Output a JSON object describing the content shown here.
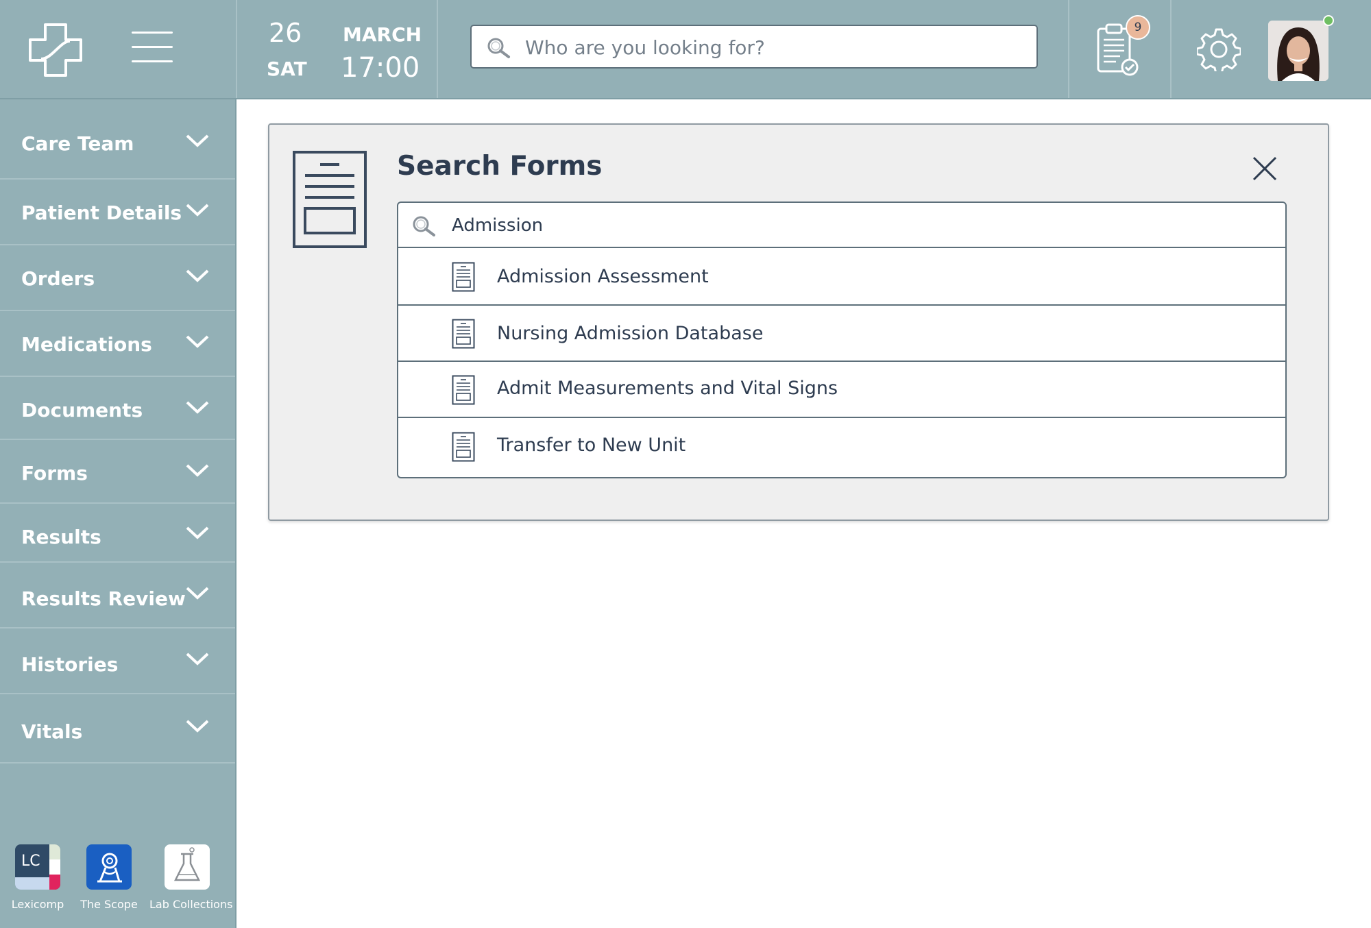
{
  "header": {
    "date_day": "26",
    "date_dow": "SAT",
    "date_month": "MARCH",
    "time": "17:00",
    "search_placeholder": "Who are you looking for?",
    "notification_count": "9",
    "logo_icon": "medical-cross-icon",
    "menu_icon": "hamburger-menu-icon",
    "tasks_icon": "clipboard-check-icon",
    "settings_icon": "gear-icon",
    "online_status_color": "#6fbe62"
  },
  "sidebar": {
    "items": [
      {
        "label": "Care Team"
      },
      {
        "label": "Patient Details"
      },
      {
        "label": "Orders"
      },
      {
        "label": "Medications"
      },
      {
        "label": "Documents"
      },
      {
        "label": "Forms"
      },
      {
        "label": "Results"
      },
      {
        "label": "Results Review"
      },
      {
        "label": "Histories"
      },
      {
        "label": "Vitals"
      }
    ],
    "apps": [
      {
        "label": "Lexicomp",
        "tile_text": "LC"
      },
      {
        "label": "The Scope"
      },
      {
        "label": "Lab Collections"
      }
    ]
  },
  "search_forms": {
    "title": "Search Forms",
    "query": "Admission",
    "results": [
      {
        "label": "Admission Assessment"
      },
      {
        "label": "Nursing Admission Database"
      },
      {
        "label": "Admit Measurements and Vital Signs"
      },
      {
        "label": "Transfer to New Unit"
      }
    ]
  },
  "colors": {
    "chrome": "#93b0b6",
    "panel": "#efefef",
    "text": "#2e3c50",
    "badge": "#e9b79a",
    "scope_app": "#1a5fc2"
  }
}
